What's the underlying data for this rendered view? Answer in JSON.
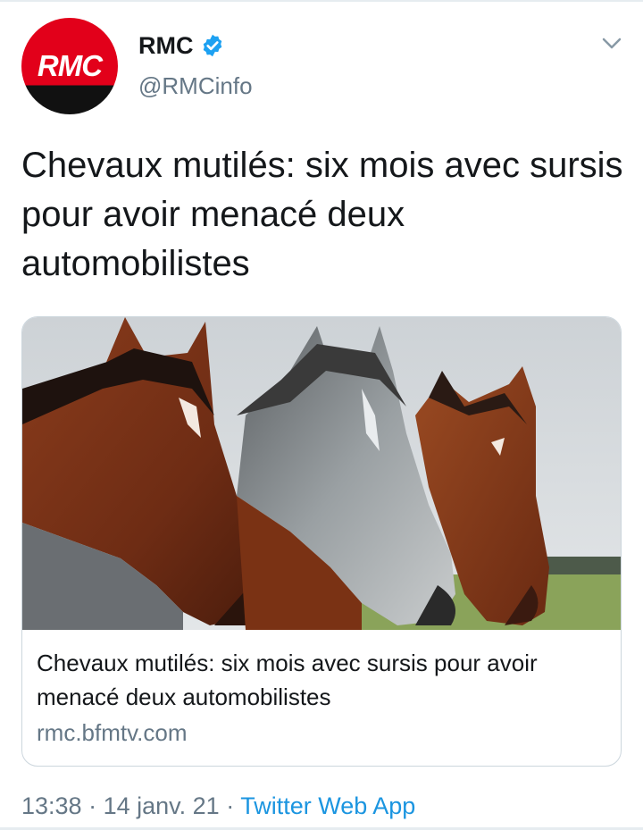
{
  "account": {
    "avatar_text": "RMC",
    "display_name": "RMC",
    "handle": "@RMCinfo",
    "verified": true,
    "brand_red": "#e2001a",
    "brand_dark": "#111111"
  },
  "tweet": {
    "text": "Chevaux mutilés: six mois avec sursis pour avoir menacé deux automobilistes"
  },
  "card": {
    "image_subject": "three horses (bay, dapple grey, bay) in a field",
    "title": "Chevaux mutilés: six mois avec sursis pour avoir menacé deux automobilistes",
    "domain": "rmc.bfmtv.com"
  },
  "meta": {
    "time": "13:38",
    "separator": " · ",
    "date": "14 janv. 21",
    "source": "Twitter Web App",
    "link_color": "#1b95e0"
  },
  "icons": {
    "verified": "verified-badge-icon",
    "caret": "chevron-down-icon"
  }
}
